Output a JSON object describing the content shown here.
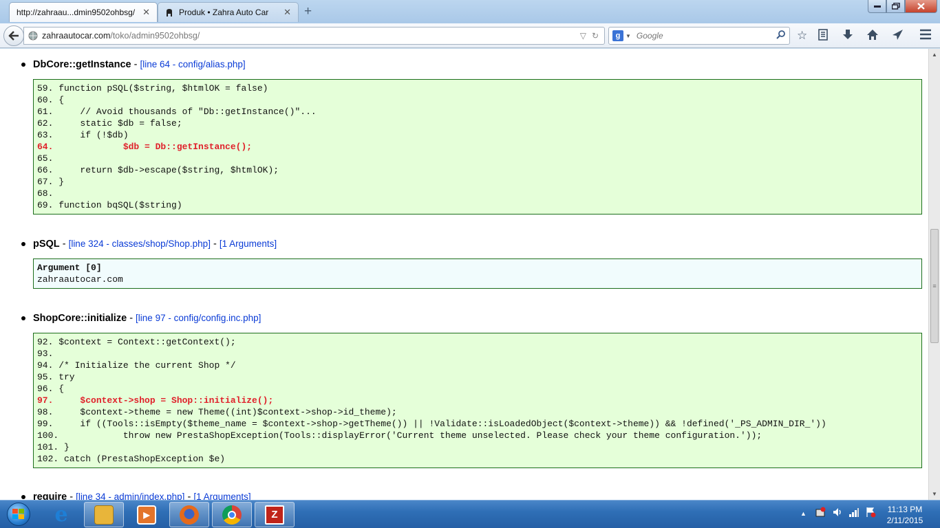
{
  "browser": {
    "tabs": [
      {
        "title": "http://zahraau...dmin9502ohbsg/",
        "active": true
      },
      {
        "title": "Produk • Zahra Auto Car",
        "active": false
      }
    ],
    "new_tab_label": "+",
    "window_controls": {
      "minimize": "‒",
      "maximize": "□",
      "close": "✕"
    },
    "url": {
      "domain": "zahraautocar.com",
      "path": "/toko/admin9502ohbsg/"
    },
    "search": {
      "engine_icon": "g-icon",
      "placeholder": "Google"
    }
  },
  "entries": [
    {
      "function": "DbCore::getInstance",
      "location": "[line 64 - config/alias.php]",
      "code": [
        {
          "text": "59. function pSQL($string, $htmlOK = false)",
          "highlight": false
        },
        {
          "text": "60. {",
          "highlight": false
        },
        {
          "text": "61.     // Avoid thousands of \"Db::getInstance()\"...",
          "highlight": false
        },
        {
          "text": "62.     static $db = false;",
          "highlight": false
        },
        {
          "text": "63.     if (!$db)",
          "highlight": false
        },
        {
          "text": "64.             $db = Db::getInstance();",
          "highlight": true
        },
        {
          "text": "65.",
          "highlight": false
        },
        {
          "text": "66.     return $db->escape($string, $htmlOK);",
          "highlight": false
        },
        {
          "text": "67. }",
          "highlight": false
        },
        {
          "text": "68.",
          "highlight": false
        },
        {
          "text": "69. function bqSQL($string)",
          "highlight": false
        }
      ]
    },
    {
      "function": "pSQL",
      "location": "[line 324 - classes/shop/Shop.php]",
      "args_link": "[1 Arguments]",
      "arguments": [
        {
          "text": "Argument [0]",
          "bold": true
        },
        {
          "text": "zahraautocar.com",
          "bold": false
        }
      ]
    },
    {
      "function": "ShopCore::initialize",
      "location": "[line 97 - config/config.inc.php]",
      "code": [
        {
          "text": "92. $context = Context::getContext();",
          "highlight": false
        },
        {
          "text": "93.",
          "highlight": false
        },
        {
          "text": "94. /* Initialize the current Shop */",
          "highlight": false
        },
        {
          "text": "95. try",
          "highlight": false
        },
        {
          "text": "96. {",
          "highlight": false
        },
        {
          "text": "97.     $context->shop = Shop::initialize();",
          "highlight": true
        },
        {
          "text": "98.     $context->theme = new Theme((int)$context->shop->id_theme);",
          "highlight": false
        },
        {
          "text": "99.     if ((Tools::isEmpty($theme_name = $context->shop->getTheme()) || !Validate::isLoadedObject($context->theme)) && !defined('_PS_ADMIN_DIR_'))",
          "highlight": false
        },
        {
          "text": "100.            throw new PrestaShopException(Tools::displayError('Current theme unselected. Please check your theme configuration.'));",
          "highlight": false
        },
        {
          "text": "101. }",
          "highlight": false
        },
        {
          "text": "102. catch (PrestaShopException $e)",
          "highlight": false
        }
      ]
    },
    {
      "function": "require",
      "location": "[line 34 - admin/index.php]",
      "args_link": "[1 Arguments]"
    }
  ],
  "taskbar": {
    "apps": [
      {
        "name": "internet-explorer-icon",
        "color": "#1e7fd6"
      },
      {
        "name": "file-explorer-icon",
        "color": "#e8b53a"
      },
      {
        "name": "media-player-icon",
        "color": "#e3742a"
      },
      {
        "name": "firefox-icon",
        "color": "#e46a1c"
      },
      {
        "name": "chrome-icon",
        "color": "#3aa757"
      },
      {
        "name": "filezilla-icon",
        "color": "#c0241a"
      }
    ],
    "clock": {
      "time": "11:13 PM",
      "date": "2/11/2015"
    }
  }
}
